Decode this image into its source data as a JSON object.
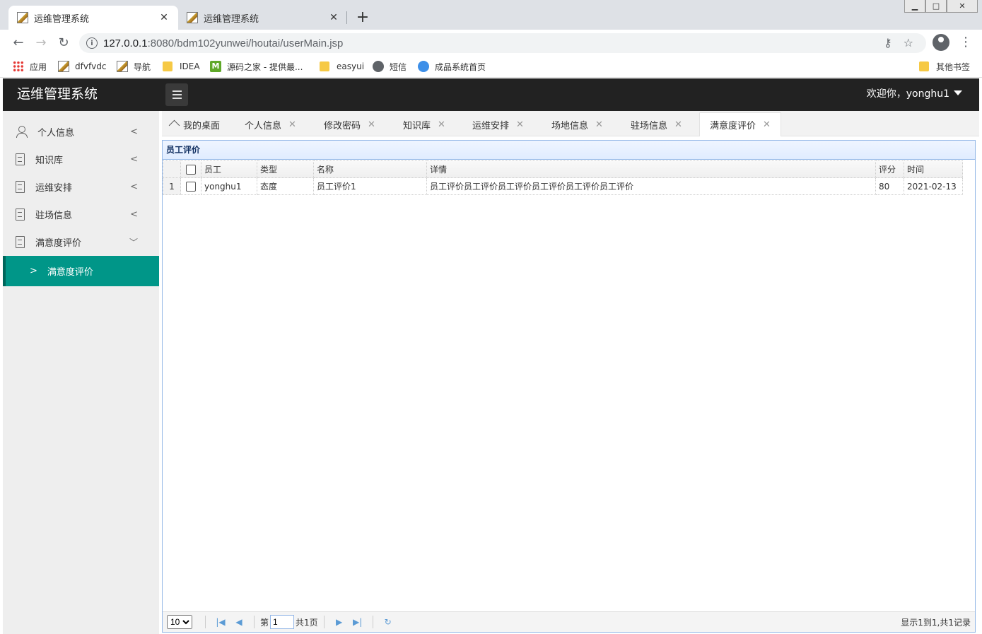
{
  "browser": {
    "tabs": [
      {
        "title": "运维管理系统",
        "active": true
      },
      {
        "title": "运维管理系统",
        "active": false
      }
    ],
    "new_tab": "+",
    "url_host": "127.0.0.1",
    "url_rest": ":8080/bdm102yunwei/houtai/userMain.jsp",
    "bookmarks": [
      "应用",
      "dfvfvdc",
      "导航",
      "IDEA",
      "源码之家 - 提供最...",
      "easyui",
      "短信",
      "成品系统首页"
    ],
    "other_bookmarks": "其他书签"
  },
  "header": {
    "app_title": "运维管理系统",
    "welcome": "欢迎你，yonghu1"
  },
  "sidebar": {
    "items": [
      {
        "label": "个人信息",
        "icon": "user-icon",
        "expanded": false
      },
      {
        "label": "知识库",
        "icon": "document-icon",
        "expanded": false
      },
      {
        "label": "运维安排",
        "icon": "document-icon",
        "expanded": false
      },
      {
        "label": "驻场信息",
        "icon": "document-icon",
        "expanded": false
      },
      {
        "label": "满意度评价",
        "icon": "document-icon",
        "expanded": true
      }
    ],
    "active_sub": "满意度评价"
  },
  "content_tabs": [
    {
      "label": "我的桌面",
      "closable": false
    },
    {
      "label": "个人信息",
      "closable": true
    },
    {
      "label": "修改密码",
      "closable": true
    },
    {
      "label": "知识库",
      "closable": true
    },
    {
      "label": "运维安排",
      "closable": true
    },
    {
      "label": "场地信息",
      "closable": true
    },
    {
      "label": "驻场信息",
      "closable": true
    },
    {
      "label": "满意度评价",
      "closable": true,
      "active": true
    }
  ],
  "panel": {
    "title": "员工评价",
    "columns": [
      "员工",
      "类型",
      "名称",
      "详情",
      "评分",
      "时间"
    ],
    "rows": [
      {
        "rownum": "1",
        "employee": "yonghu1",
        "type": "态度",
        "name": "员工评价1",
        "detail": "员工评价员工评价员工评价员工评价员工评价员工评价",
        "score": "80",
        "time": "2021-02-13"
      }
    ]
  },
  "pager": {
    "page_size": "10",
    "page_label_prefix": "第",
    "page_value": "1",
    "page_total": "共1页",
    "info": "显示1到1,共1记录"
  },
  "colors": {
    "header_bg": "#222222",
    "accent": "#009688",
    "panel_border": "#95b8e7"
  }
}
